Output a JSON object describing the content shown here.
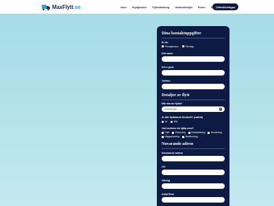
{
  "header": {
    "logo": {
      "brand": "MaxFlytt",
      "tld": ".se"
    },
    "nav": [
      "Hem",
      "Flyttjänster",
      "Flyttstädning",
      "Utandskeflytt",
      "Priser",
      "Kontakt"
    ],
    "cta": "Offertförfrågan"
  },
  "form": {
    "contact": {
      "title": "Dina kontaktuppgifter",
      "type_label": "Är du",
      "type_options": [
        "Privatperson",
        "Företag"
      ],
      "name_label": "Ditt namn",
      "email_label": "Din e-post",
      "phone_label": "Telefon"
    },
    "move": {
      "title": "Detaljer av flytt",
      "date_label": "När ska du flytta?",
      "date_placeholder": "mm/dd/yyyy",
      "flexible_label": "Är ditt flyttdatum flexibelt? (valfritt)",
      "flexible_options": [
        "Ja",
        "Nej"
      ],
      "help_label": "Vad behöver du hjälp med?",
      "help_options": [
        "Flytt",
        "Packning",
        "Flyttstädning",
        "Montering",
        "Magasinering",
        "Bortforsling"
      ]
    },
    "current": {
      "title": "Nuvarande adress",
      "address_label": "Nuvarande adress",
      "city_label": "Ort",
      "floor_label": "Våning",
      "rooms_label": "Antal Rum"
    }
  },
  "colors": {
    "card": "#0d1b44",
    "background": "#a7dce8",
    "accent": "#2ea7d6"
  }
}
